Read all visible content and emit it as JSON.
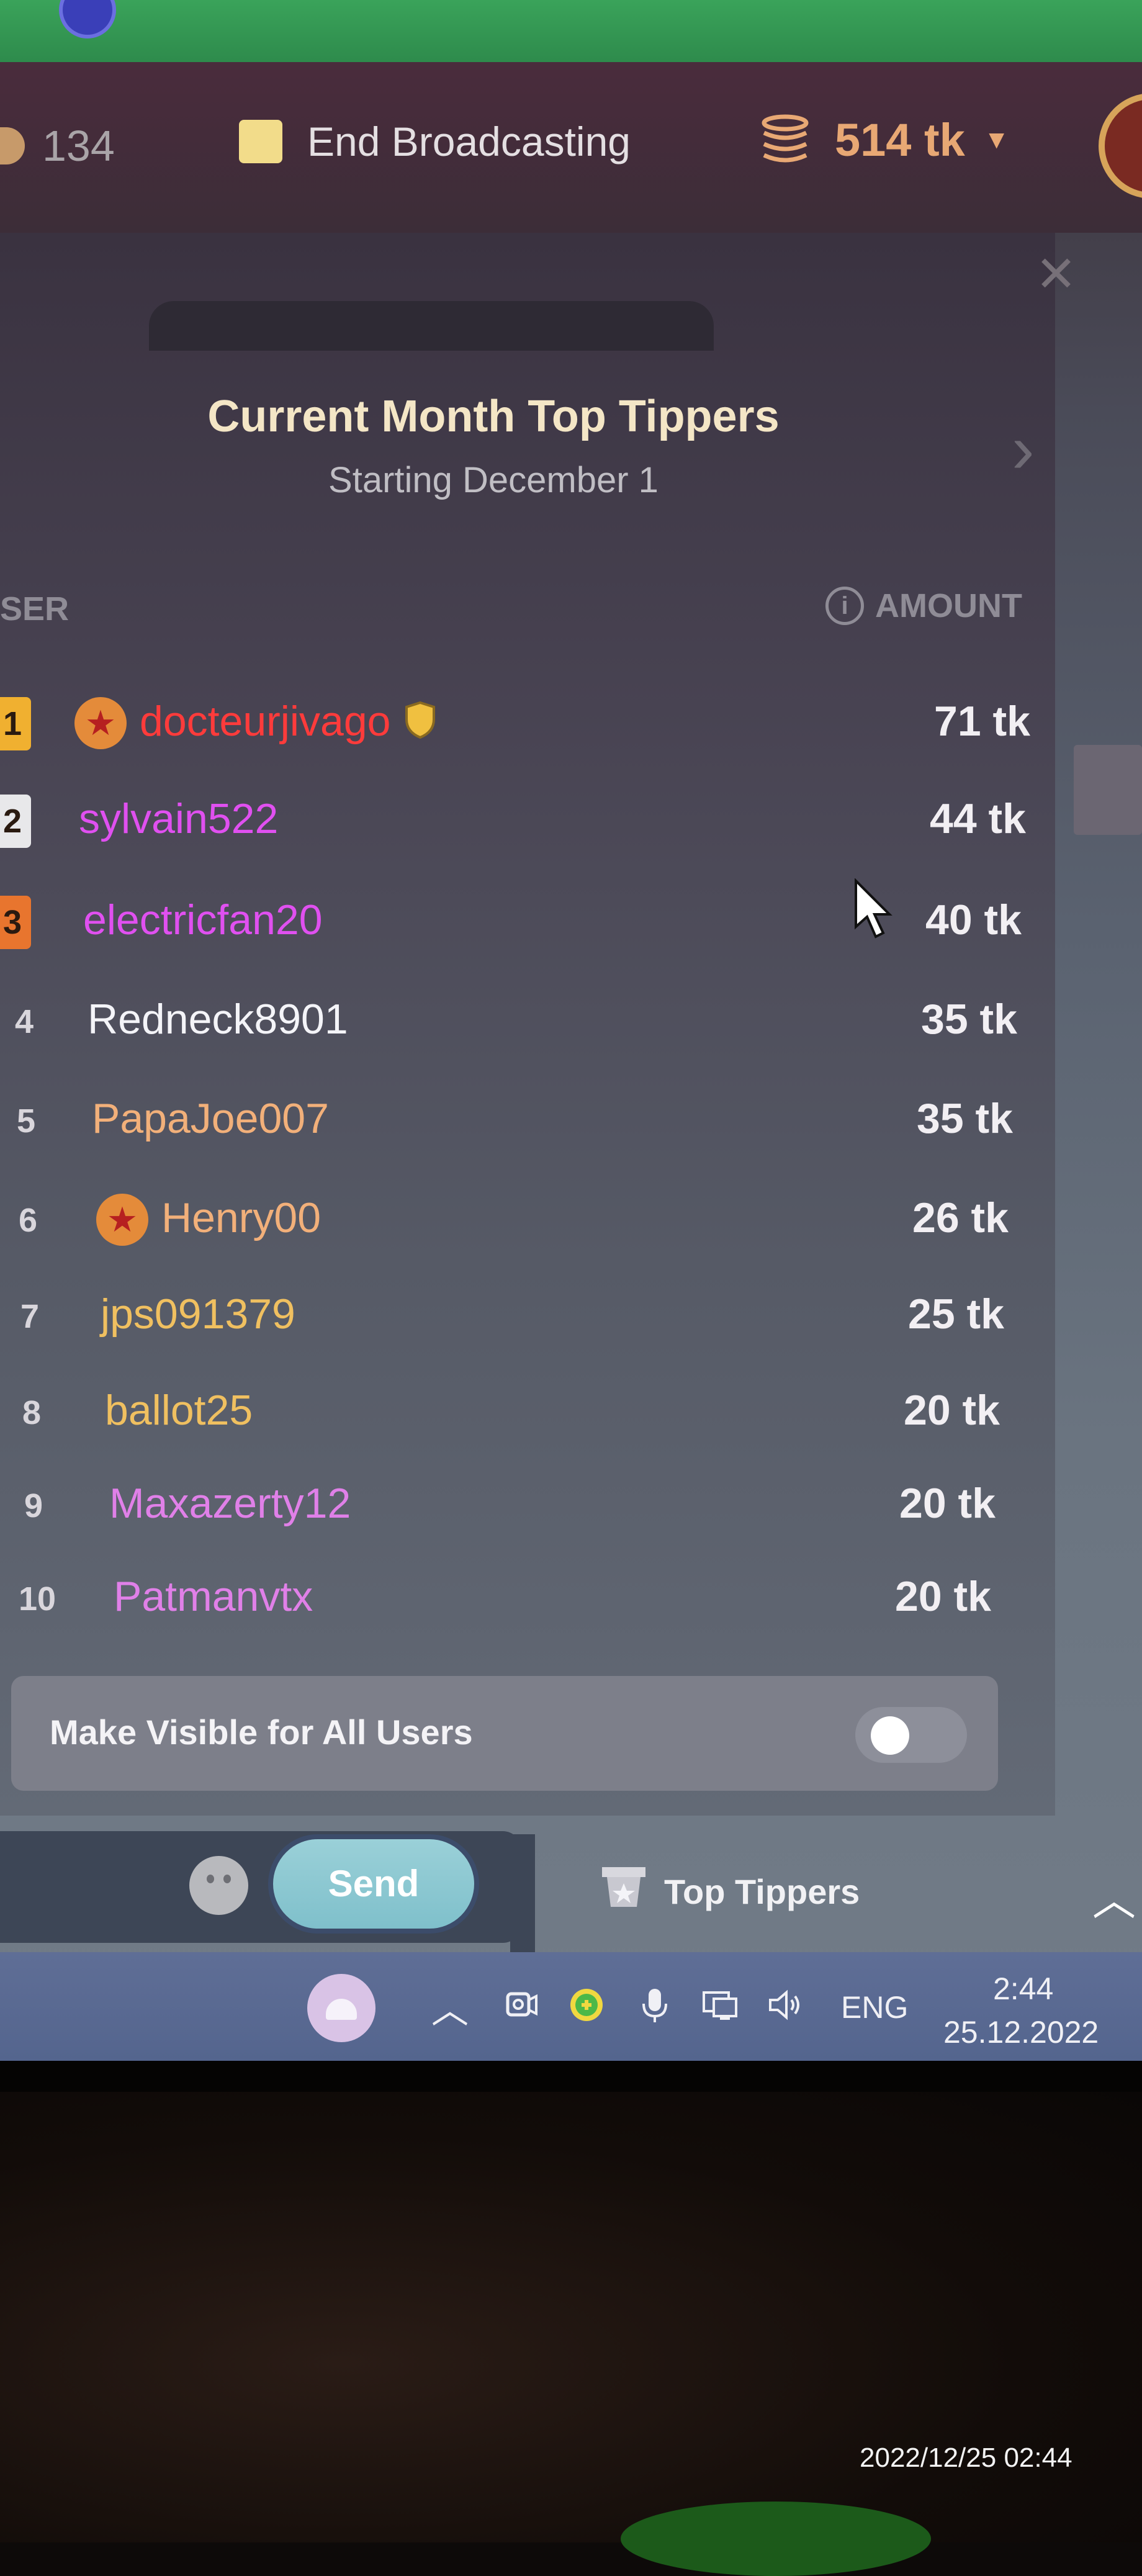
{
  "header": {
    "viewers_count": "134",
    "end_broadcast_label": "End Broadcasting",
    "token_balance": "514 tk"
  },
  "panel": {
    "title": "Current Month Top Tippers",
    "subtitle": "Starting December 1",
    "col_user": "SER",
    "col_amount": "AMOUNT",
    "rows": [
      {
        "rank": "1",
        "name": "docteurjivago",
        "amount": "71 tk",
        "color": "#ff3b3b",
        "badge_color": "#f0b030",
        "has_star": true,
        "has_shield": true
      },
      {
        "rank": "2",
        "name": "sylvain522",
        "amount": "44 tk",
        "color": "#e050f0",
        "badge_color": "#e8e8ea"
      },
      {
        "rank": "3",
        "name": "electricfan20",
        "amount": "40 tk",
        "color": "#e050f0",
        "badge_color": "#e8752e"
      },
      {
        "rank": "4",
        "name": "Redneck8901",
        "amount": "35 tk",
        "color": "#f4f4f8"
      },
      {
        "rank": "5",
        "name": "PapaJoe007",
        "amount": "35 tk",
        "color": "#f2b07a"
      },
      {
        "rank": "6",
        "name": "Henry00",
        "amount": "26 tk",
        "color": "#f2b07a",
        "has_star": true
      },
      {
        "rank": "7",
        "name": "jps091379",
        "amount": "25 tk",
        "color": "#f0c060"
      },
      {
        "rank": "8",
        "name": "ballot25",
        "amount": "20 tk",
        "color": "#f0c060"
      },
      {
        "rank": "9",
        "name": "Maxazerty12",
        "amount": "20 tk",
        "color": "#e080e8"
      },
      {
        "rank": "10",
        "name": "Patmanvtx",
        "amount": "20 tk",
        "color": "#e080e8"
      }
    ],
    "visible_toggle_label": "Make Visible for All Users",
    "visible_toggle_on": false
  },
  "footer": {
    "send_label": "Send",
    "top_tippers_label": "Top Tippers"
  },
  "taskbar": {
    "language": "ENG",
    "time": "2:44",
    "date": "25.12.2022"
  },
  "photo": {
    "timestamp": "2022/12/25 02:44"
  }
}
